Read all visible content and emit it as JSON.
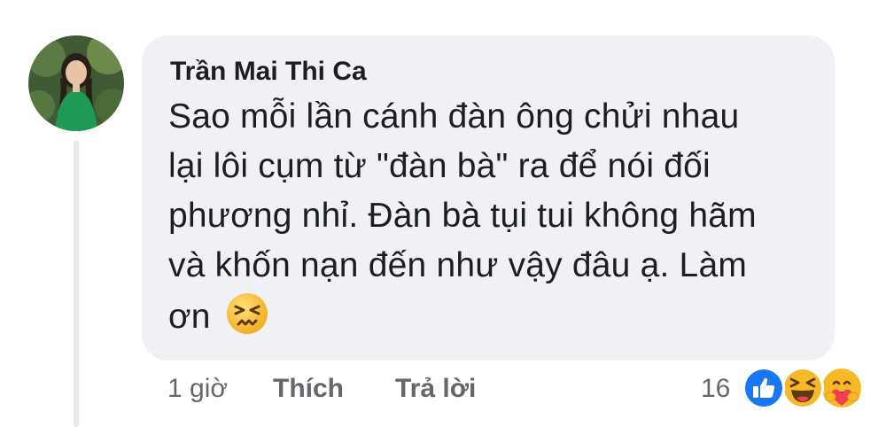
{
  "comment": {
    "author": "Trần Mai Thi Ca",
    "lines": [
      "Sao mỗi lần cánh đàn ông chửi nhau",
      "lại lôi cụm từ \"đàn bà\" ra để nói đối",
      "phương nhỉ. Đàn bà tụi tui không hãm",
      "và khốn nạn đến như vậy đâu ạ. Làm",
      "ơn"
    ],
    "trailing_emoji": "persevering-face-icon"
  },
  "actions": {
    "time": "1 giờ",
    "like_label": "Thích",
    "reply_label": "Trả lời"
  },
  "reactions": {
    "count": "16",
    "types": [
      "like-icon",
      "haha-icon",
      "care-icon"
    ]
  },
  "colors": {
    "bubble": "#eff1f4",
    "text": "#1c1e21",
    "meta": "#65676b",
    "like_blue": "#1877f2",
    "emoji_yellow": "#f7b928"
  }
}
